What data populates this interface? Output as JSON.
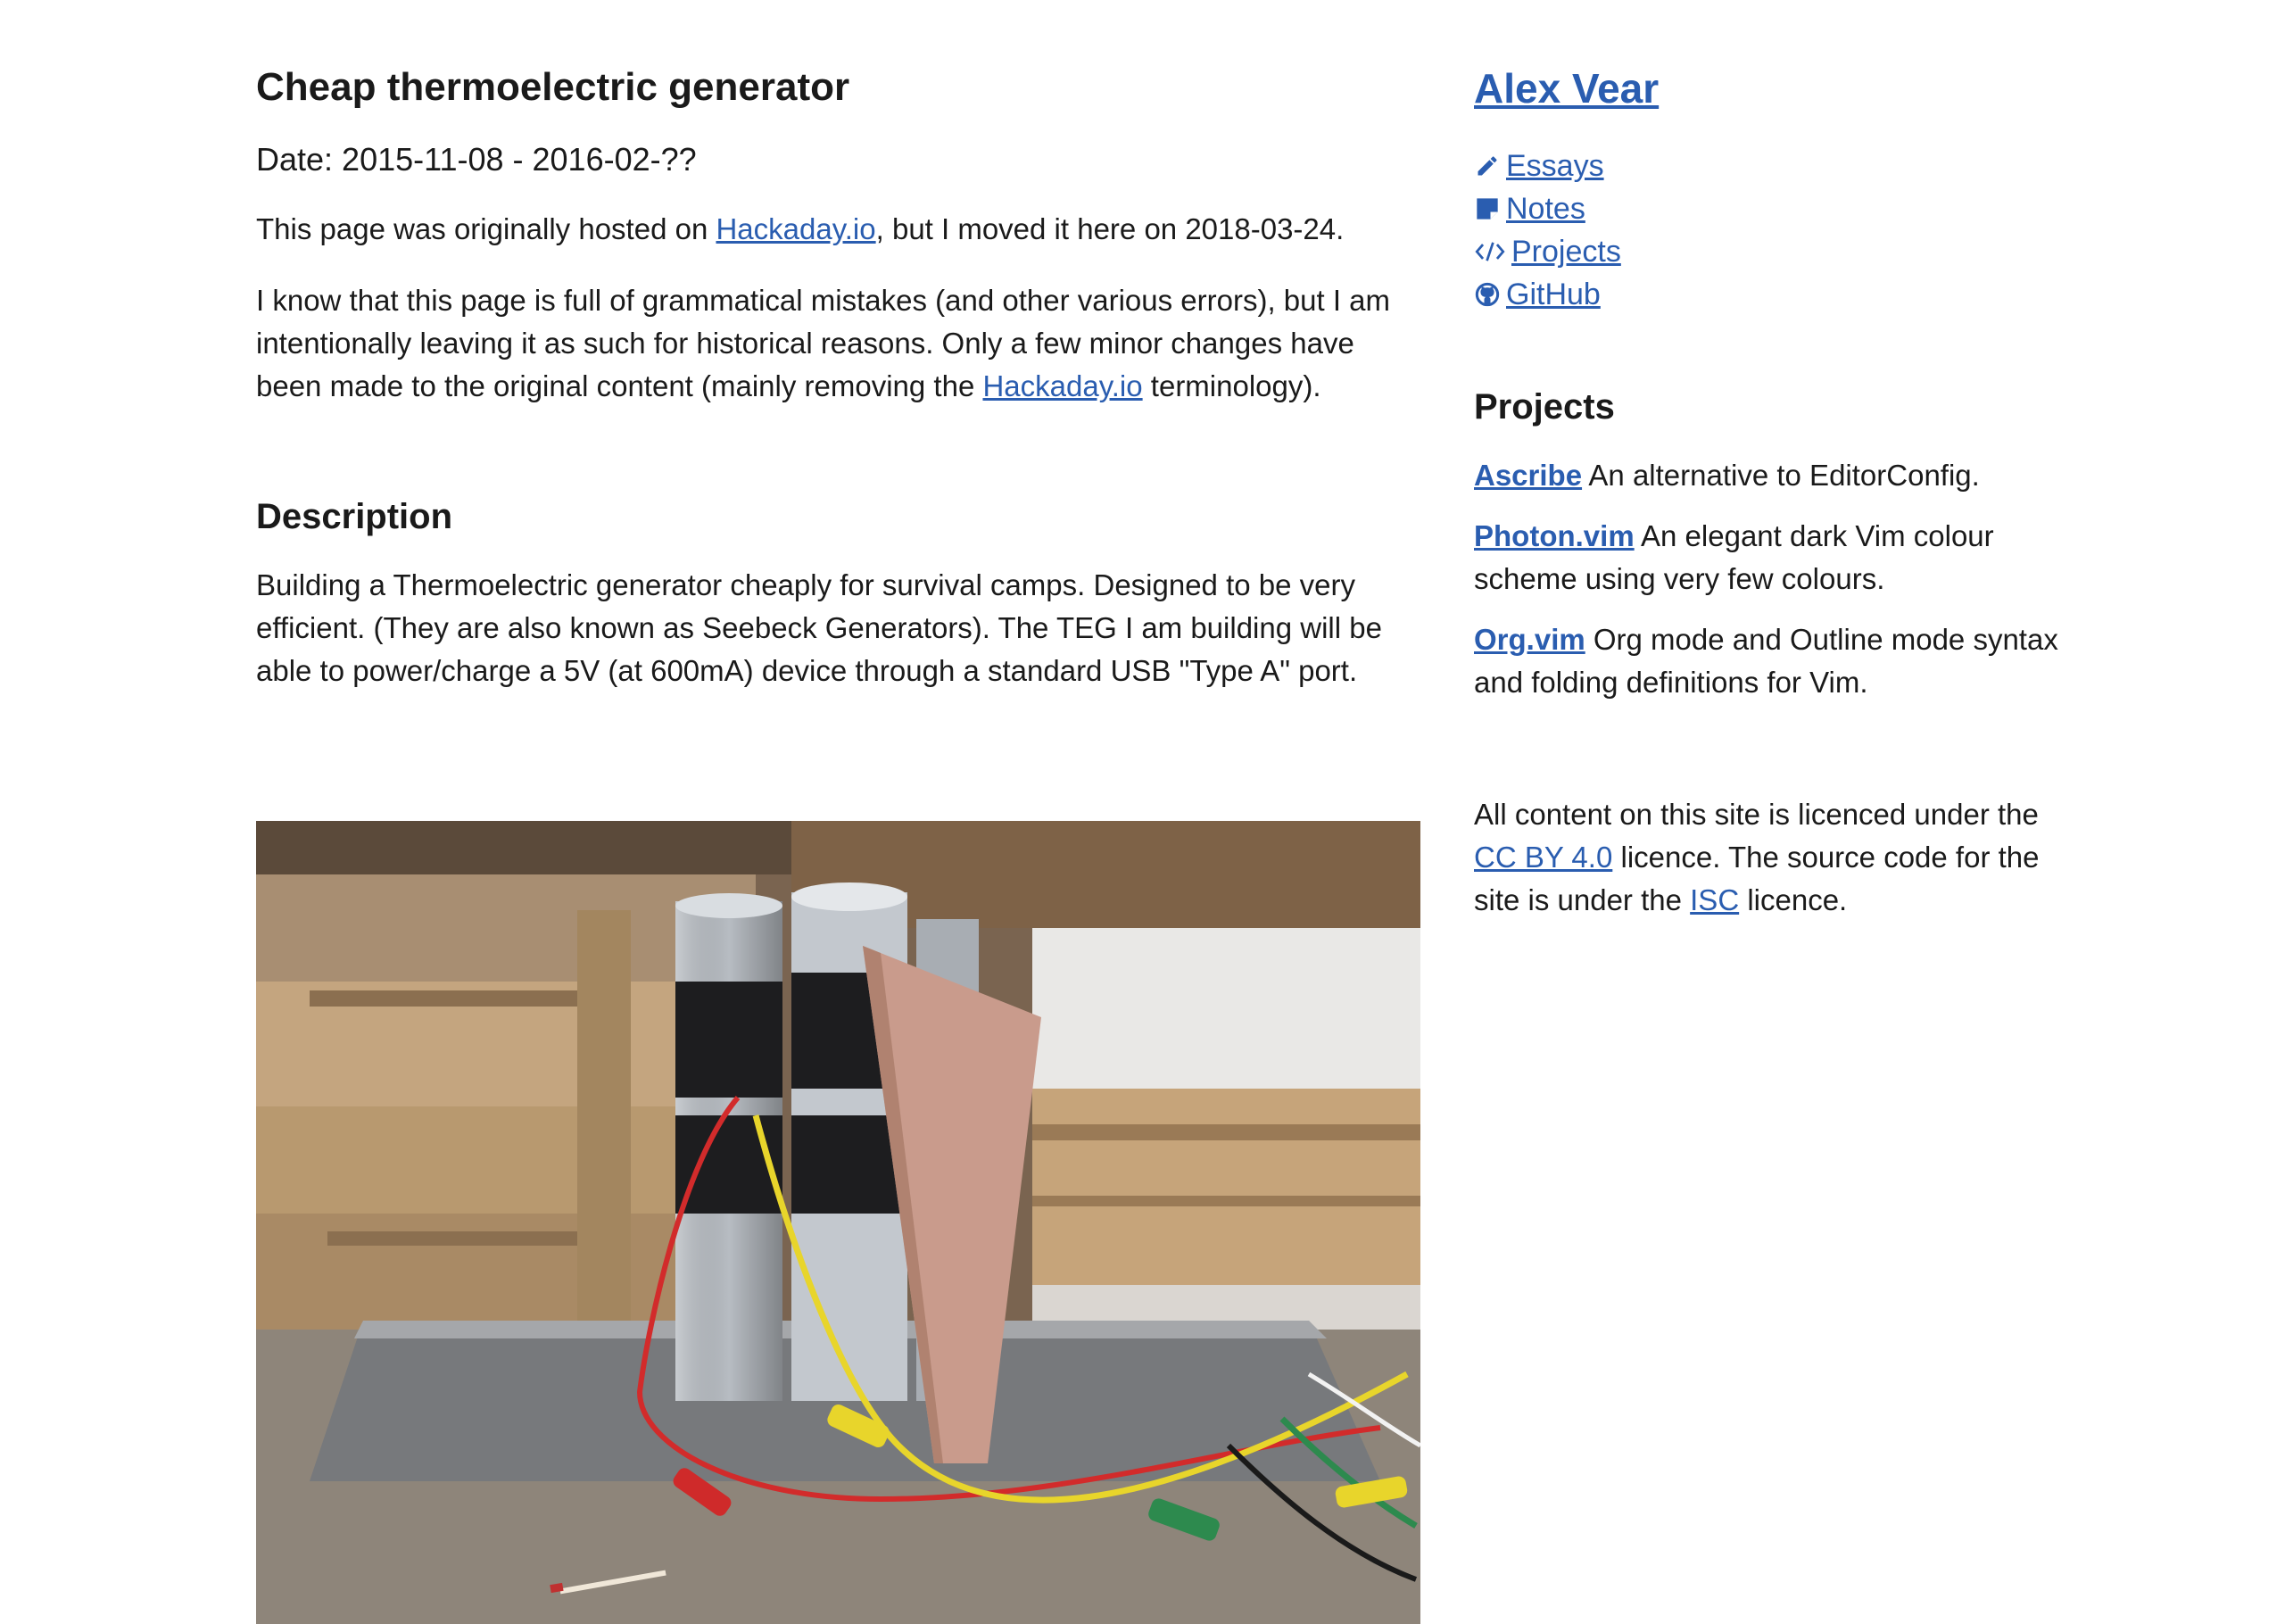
{
  "article": {
    "title": "Cheap thermoelectric generator",
    "date": "Date: 2015-11-08 - 2016-02-??",
    "intro1": {
      "before": "This page was originally hosted on ",
      "link": "Hackaday.io",
      "after": ", but I moved it here on 2018-03-24."
    },
    "intro2": {
      "before": "I know that this page is full of grammatical mistakes (and other various errors), but I am intentionally leaving it as such for historical reasons. Only a few minor changes have been made to the original content (mainly removing the ",
      "link": "Hackaday.io",
      "after": " terminology)."
    },
    "description_heading": "Description",
    "description": "Building a Thermoelectric generator cheaply for survival camps. Designed to be very efficient. (They are also known as Seebeck Generators). The TEG I am building will be able to power/charge a 5V (at 600mA) device through a standard USB \"Type A\" port."
  },
  "sidebar": {
    "site_title": "Alex Vear",
    "nav": [
      {
        "label": "Essays",
        "icon": "pencil-icon"
      },
      {
        "label": "Notes",
        "icon": "sticky-note-icon"
      },
      {
        "label": "Projects",
        "icon": "code-icon"
      },
      {
        "label": "GitHub",
        "icon": "github-icon"
      }
    ],
    "projects_heading": "Projects",
    "projects": [
      {
        "name": "Ascribe",
        "desc": " An alternative to EditorConfig."
      },
      {
        "name": "Photon.vim",
        "desc": " An elegant dark Vim colour scheme using very few colours."
      },
      {
        "name": "Org.vim",
        "desc": " Org mode and Outline mode syntax and folding definitions for Vim."
      }
    ],
    "license": {
      "before": "All content on this site is licenced under the ",
      "link1": "CC BY 4.0",
      "middle": " licence. The source code for the site is under the ",
      "link2": "ISC",
      "after": " licence."
    }
  },
  "colors": {
    "link": "#2a5db0",
    "text": "#1a1a1a"
  }
}
